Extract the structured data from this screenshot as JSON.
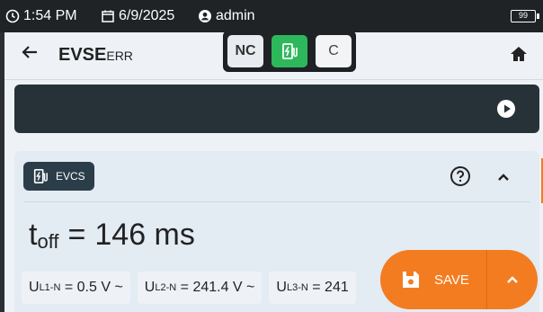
{
  "status": {
    "time": "1:54 PM",
    "date": "6/9/2025",
    "user": "admin",
    "battery": "99"
  },
  "appbar": {
    "title_main": "EVSE",
    "title_sub": "ERR",
    "segment": {
      "nc_label": "NC",
      "c_label": "C",
      "selected": "evse"
    }
  },
  "card": {
    "chip_label": "EVCS",
    "toff": {
      "symbol": "t",
      "subscript": "off",
      "equals": "=",
      "value": "146 ms"
    },
    "readings": [
      {
        "symbol": "U",
        "subscript": "L1-N",
        "value": "= 0.5 V ~"
      },
      {
        "symbol": "U",
        "subscript": "L2-N",
        "value": "= 241.4 V ~"
      },
      {
        "symbol": "U",
        "subscript": "L3-N",
        "value": "= 241"
      }
    ]
  },
  "fab": {
    "save_label": "SAVE"
  },
  "colors": {
    "accent_orange": "#f47c20",
    "active_green": "#2eb85c",
    "dark": "#273238"
  }
}
